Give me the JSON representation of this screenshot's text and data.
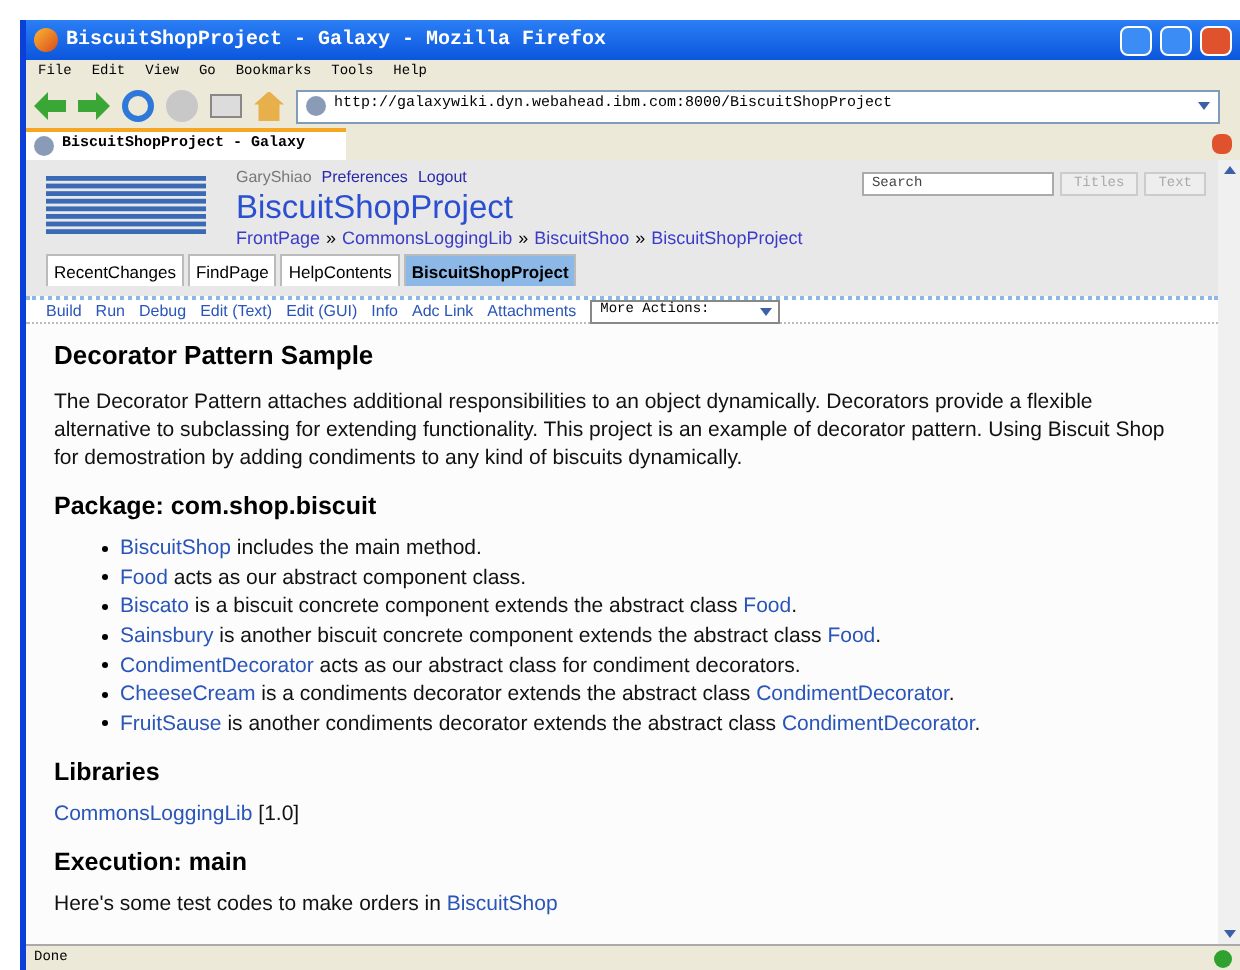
{
  "window": {
    "title": "BiscuitShopProject - Galaxy - Mozilla Firefox"
  },
  "menu": [
    "File",
    "Edit",
    "View",
    "Go",
    "Bookmarks",
    "Tools",
    "Help"
  ],
  "address": {
    "value": "http://galaxywiki.dyn.webahead.ibm.com:8000/BiscuitShopProject"
  },
  "browser_tab": {
    "title": "BiscuitShopProject - Galaxy"
  },
  "user_links": [
    {
      "label": "GaryShiao",
      "kind": "user"
    },
    {
      "label": "Preferences",
      "kind": "link"
    },
    {
      "label": "Logout",
      "kind": "link"
    }
  ],
  "search": {
    "placeholder": "Search",
    "buttons": [
      "Titles",
      "Text"
    ]
  },
  "page_title": "BiscuitShopProject",
  "breadcrumb": [
    {
      "label": "FrontPage"
    },
    {
      "sep": "»",
      "label": "CommonsLoggingLib"
    },
    {
      "sep": "»",
      "label": "BiscuitShoo"
    },
    {
      "sep": "»",
      "label": "BiscuitShopProject"
    }
  ],
  "nav_tabs": [
    {
      "label": "RecentChanges",
      "selected": false
    },
    {
      "label": "FindPage",
      "selected": false
    },
    {
      "label": "HelpContents",
      "selected": false
    },
    {
      "label": "BiscuitShopProject",
      "selected": true
    }
  ],
  "actions": [
    "Build",
    "Run",
    "Debug",
    "Edit (Text)",
    "Edit (GUI)",
    "Info",
    "Adc Link",
    "Attachments"
  ],
  "more_actions": {
    "value": "More Actions:"
  },
  "content": [
    {
      "kind": "h1",
      "text": "Decorator Pattern Sample"
    },
    {
      "kind": "p",
      "parts": [
        {
          "text": "The Decorator Pattern attaches additional responsibilities to an object dynamically. Decorators provide a flexible alternative to subclassing for extending functionality. This project is an example of decorator pattern. Using Biscuit Shop for demostration by adding condiments to any kind of biscuits dynamically."
        }
      ]
    },
    {
      "kind": "h2",
      "text": "Package: com.shop.biscuit"
    },
    {
      "kind": "list",
      "items": [
        [
          {
            "text": "BiscuitShop",
            "link": true
          },
          {
            "text": " includes the main method."
          }
        ],
        [
          {
            "text": "Food",
            "link": true
          },
          {
            "text": " acts as our abstract component class."
          }
        ],
        [
          {
            "text": "Biscato",
            "link": true
          },
          {
            "text": " is a biscuit concrete component extends the abstract class "
          },
          {
            "text": "Food",
            "link": true
          },
          {
            "text": "."
          }
        ],
        [
          {
            "text": "Sainsbury",
            "link": true
          },
          {
            "text": " is another biscuit concrete component extends the abstract class "
          },
          {
            "text": "Food",
            "link": true
          },
          {
            "text": "."
          }
        ],
        [
          {
            "text": "CondimentDecorator",
            "link": true
          },
          {
            "text": " acts as our abstract class for condiment decorators."
          }
        ],
        [
          {
            "text": "CheeseCream",
            "link": true
          },
          {
            "text": " is a condiments decorator extends the abstract class "
          },
          {
            "text": "CondimentDecorator",
            "link": true
          },
          {
            "text": "."
          }
        ],
        [
          {
            "text": "FruitSause",
            "link": true
          },
          {
            "text": " is another condiments decorator extends the abstract class "
          },
          {
            "text": "CondimentDecorator",
            "link": true
          },
          {
            "text": "."
          }
        ]
      ]
    },
    {
      "kind": "h2",
      "text": "Libraries"
    },
    {
      "kind": "p",
      "parts": [
        {
          "text": "CommonsLoggingLib",
          "link": true
        },
        {
          "text": " [1.0]"
        }
      ]
    },
    {
      "kind": "h2",
      "text": "Execution: main"
    },
    {
      "kind": "p",
      "parts": [
        {
          "text": "Here's some test codes to make orders in "
        },
        {
          "text": "BiscuitShop",
          "link": true
        }
      ]
    }
  ],
  "status_bar": {
    "text": "Done"
  }
}
